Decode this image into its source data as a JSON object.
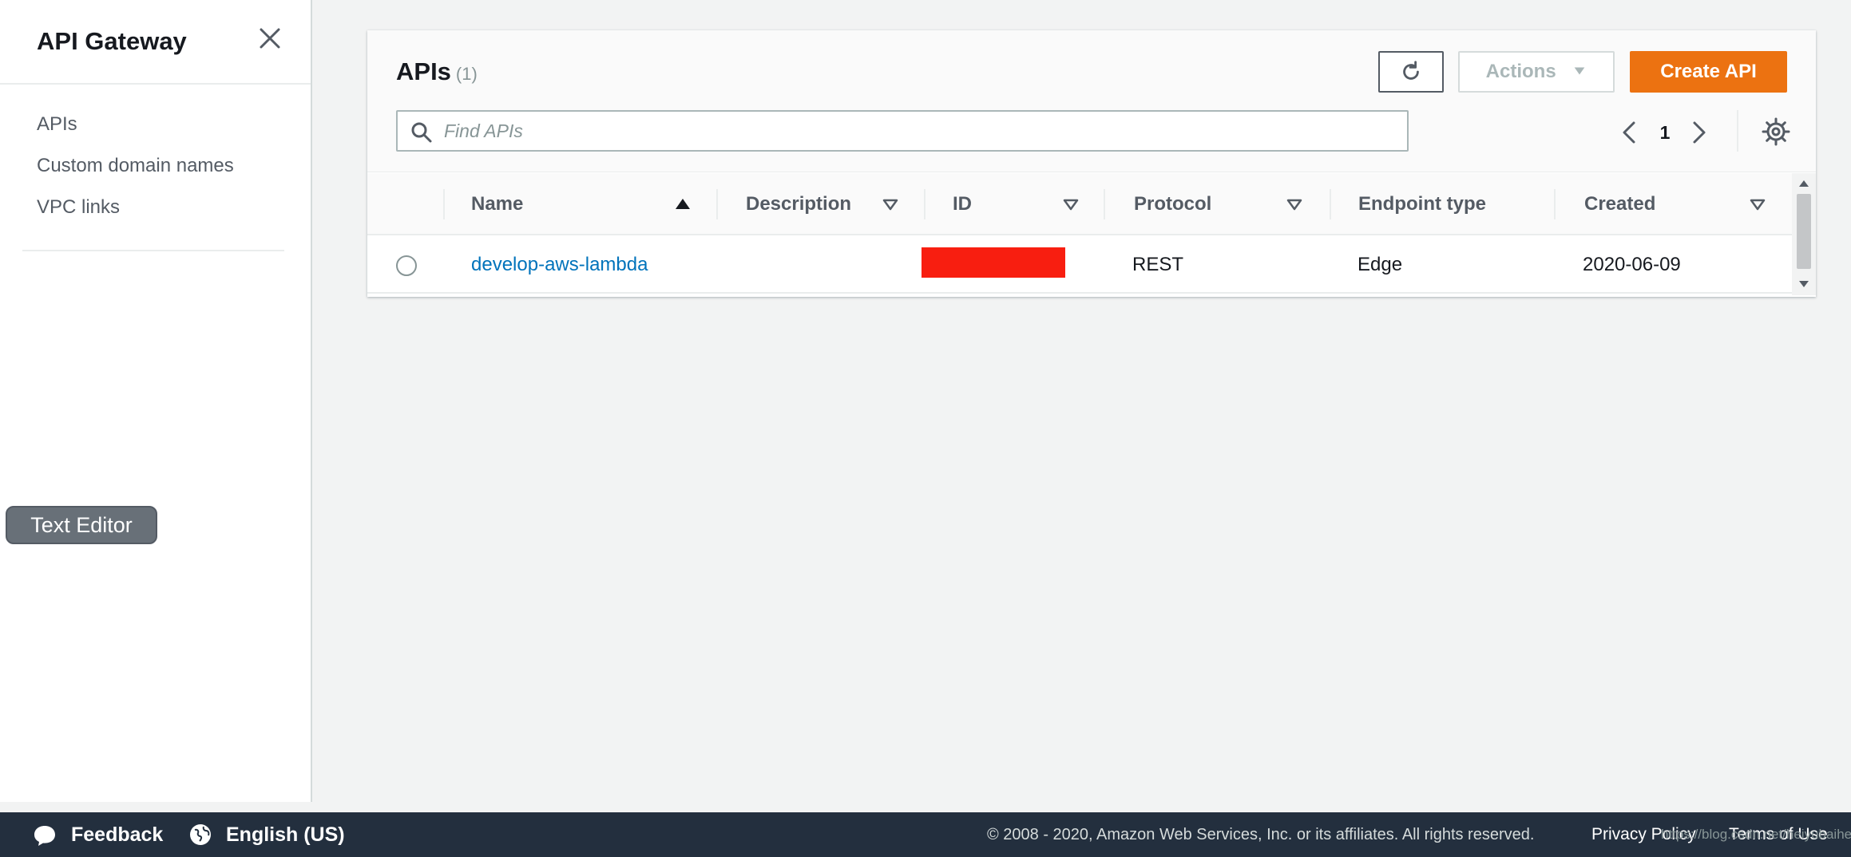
{
  "sidebar": {
    "title": "API Gateway",
    "items": [
      {
        "label": "APIs"
      },
      {
        "label": "Custom domain names"
      },
      {
        "label": "VPC links"
      }
    ]
  },
  "text_editor_pill": "Text Editor",
  "panel": {
    "title": "APIs",
    "count": "(1)",
    "actions_label": "Actions",
    "create_label": "Create API",
    "search": {
      "placeholder": "Find APIs"
    },
    "pagination": {
      "current_page": "1"
    },
    "columns": [
      {
        "label": "Name",
        "sort": "ascending"
      },
      {
        "label": "Description",
        "sort": "none"
      },
      {
        "label": "ID",
        "sort": "none"
      },
      {
        "label": "Protocol",
        "sort": "none"
      },
      {
        "label": "Endpoint type",
        "sort": "none"
      },
      {
        "label": "Created",
        "sort": "none"
      }
    ],
    "rows": [
      {
        "name": "develop-aws-lambda",
        "description": "",
        "id_redacted": true,
        "protocol": "REST",
        "endpoint_type": "Edge",
        "created": "2020-06-09"
      }
    ]
  },
  "footer": {
    "feedback_label": "Feedback",
    "language_label": "English (US)",
    "copyright": "© 2008 - 2020, Amazon Web Services, Inc. or its affiliates. All rights reserved.",
    "privacy_label": "Privacy Policy",
    "terms_label": "Terms of Use"
  },
  "watermark": "https://blog.csdn.net/heiyubaihe",
  "colors": {
    "accent": "#ec7211",
    "link": "#0073bb",
    "footer_bg": "#232f3e",
    "redaction": "#f81e10"
  },
  "icons": [
    "close-icon",
    "refresh-icon",
    "caret-down-icon",
    "search-icon",
    "chevron-left-icon",
    "chevron-right-icon",
    "settings-icon",
    "sort-asc-icon",
    "sort-icon",
    "feedback-icon",
    "globe-icon"
  ]
}
